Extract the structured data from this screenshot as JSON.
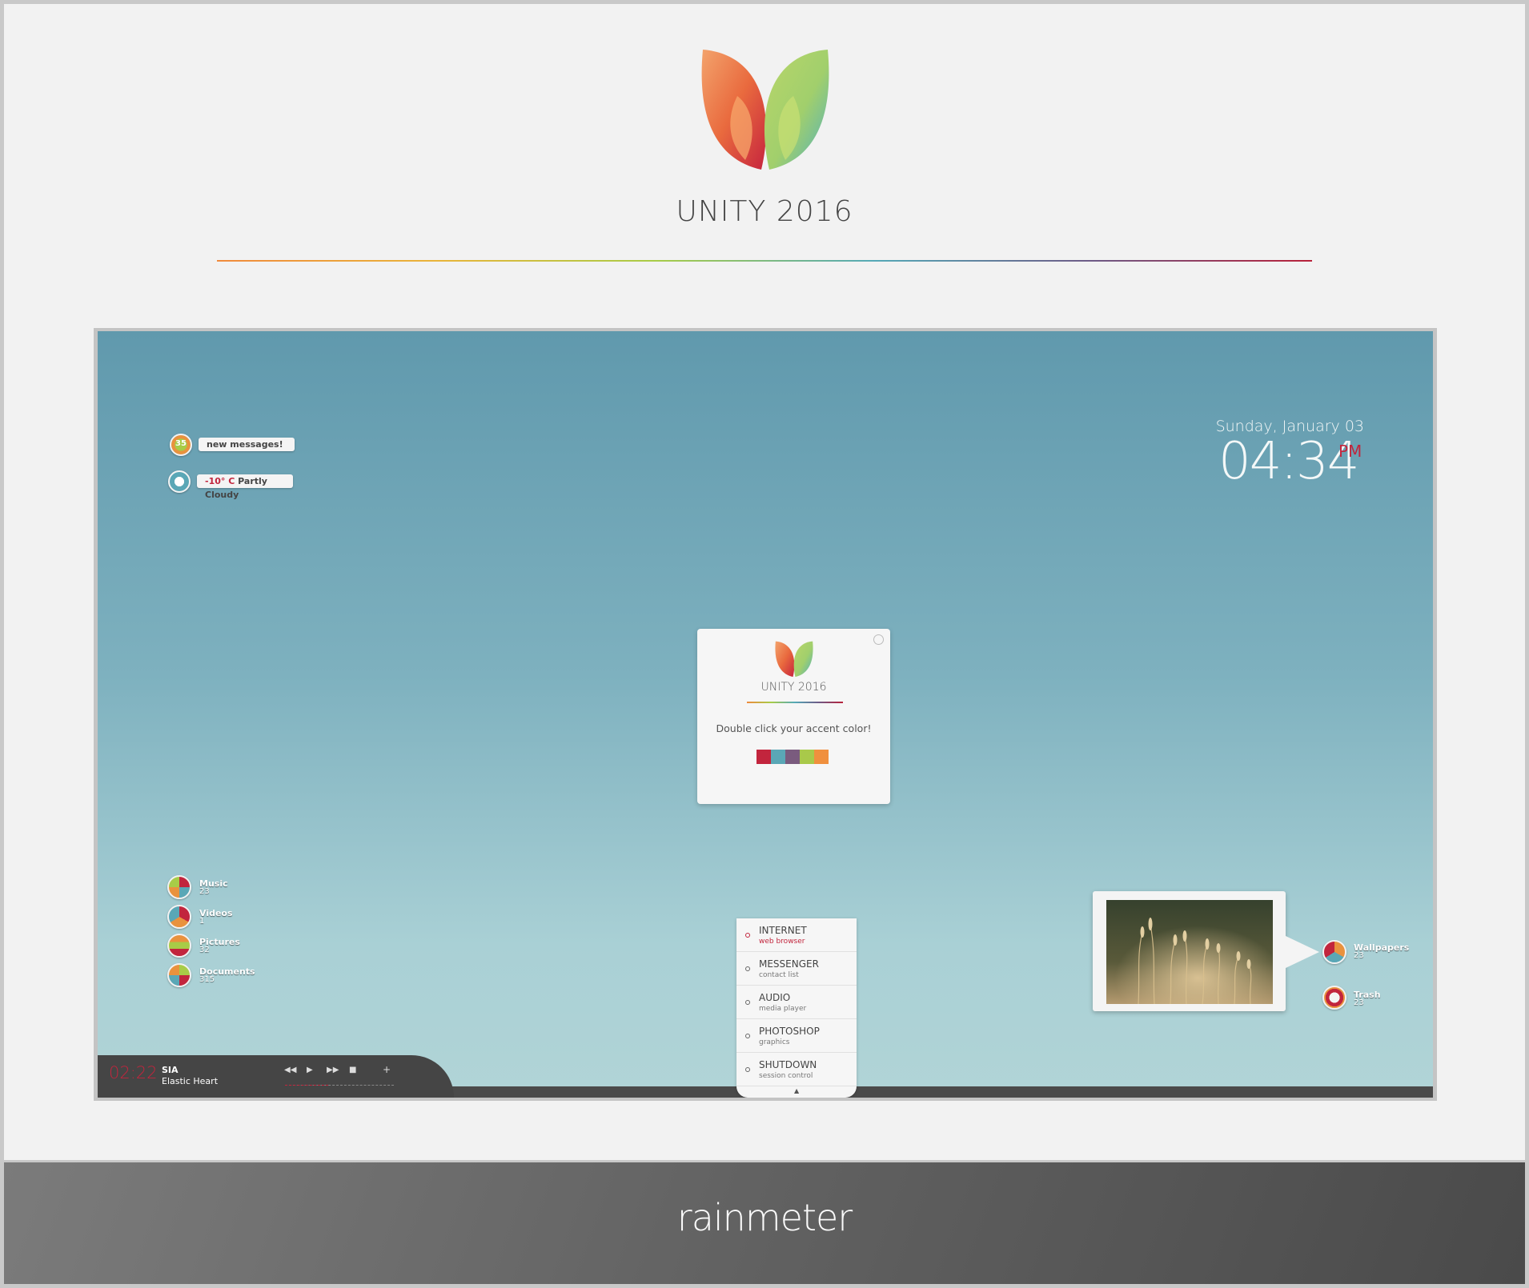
{
  "header": {
    "title": "UNITY 2016"
  },
  "widgets": {
    "messages": {
      "count": "35",
      "text": "new messages!"
    },
    "weather": {
      "temp": "-10° C",
      "condition": "Partly Cloudy"
    }
  },
  "clock": {
    "date": "Sunday, January 03",
    "time": "04:34",
    "ampm": "PM"
  },
  "welcome": {
    "title": "UNITY 2016",
    "instruction": "Double click your accent color!",
    "accent_colors": [
      "#c2253d",
      "#5aa7b6",
      "#7a5b7e",
      "#a9c94a",
      "#f0903e"
    ]
  },
  "shortcuts": [
    {
      "label": "Music",
      "count": "23"
    },
    {
      "label": "Videos",
      "count": "1"
    },
    {
      "label": "Pictures",
      "count": "32"
    },
    {
      "label": "Documents",
      "count": "315"
    }
  ],
  "launcher": [
    {
      "title": "INTERNET",
      "subtitle": "web browser"
    },
    {
      "title": "MESSENGER",
      "subtitle": "contact list"
    },
    {
      "title": "AUDIO",
      "subtitle": "media player"
    },
    {
      "title": "PHOTOSHOP",
      "subtitle": "graphics"
    },
    {
      "title": "SHUTDOWN",
      "subtitle": "session control"
    }
  ],
  "player": {
    "time": "02:22",
    "artist": "SIA",
    "song": "Elastic Heart",
    "progress": 0.4
  },
  "right_icons": [
    {
      "label": "Wallpapers",
      "count": "23"
    },
    {
      "label": "Trash",
      "count": "23"
    }
  ],
  "footer": {
    "brand": "rainmeter"
  },
  "colors": {
    "accent": "#c2253d",
    "panel": "#f4f4f4",
    "bar": "#4a4a4a"
  }
}
